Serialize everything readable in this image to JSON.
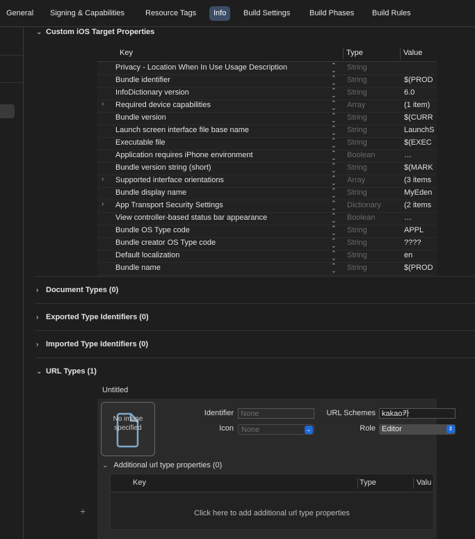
{
  "tabs": [
    "General",
    "Signing & Capabilities",
    "Resource Tags",
    "Info",
    "Build Settings",
    "Build Phases",
    "Build Rules"
  ],
  "active_tab": "Info",
  "sections": {
    "custom_ios": "Custom iOS Target Properties",
    "document_types": "Document Types (0)",
    "exported_types": "Exported Type Identifiers (0)",
    "imported_types": "Imported Type Identifiers (0)",
    "url_types": "URL Types (1)"
  },
  "plist_headers": {
    "key": "Key",
    "type": "Type",
    "value": "Value"
  },
  "plist_rows": [
    {
      "key": "Privacy - Location When In Use Usage Description",
      "type": "String",
      "value": "",
      "expandable": false
    },
    {
      "key": "Bundle identifier",
      "type": "String",
      "value": "$(PROD",
      "expandable": false
    },
    {
      "key": "InfoDictionary version",
      "type": "String",
      "value": "6.0",
      "expandable": false
    },
    {
      "key": "Required device capabilities",
      "type": "Array",
      "value": "(1 item)",
      "expandable": true
    },
    {
      "key": "Bundle version",
      "type": "String",
      "value": "$(CURR",
      "expandable": false
    },
    {
      "key": "Launch screen interface file base name",
      "type": "String",
      "value": "LaunchS",
      "expandable": false
    },
    {
      "key": "Executable file",
      "type": "String",
      "value": "$(EXEC",
      "expandable": false
    },
    {
      "key": "Application requires iPhone environment",
      "type": "Boolean",
      "value": "…",
      "expandable": false
    },
    {
      "key": "Bundle version string (short)",
      "type": "String",
      "value": "$(MARK",
      "expandable": false
    },
    {
      "key": "Supported interface orientations",
      "type": "Array",
      "value": "(3 items",
      "expandable": true
    },
    {
      "key": "Bundle display name",
      "type": "String",
      "value": "MyEden",
      "expandable": false
    },
    {
      "key": "App Transport Security Settings",
      "type": "Dictionary",
      "value": "(2 items",
      "expandable": true
    },
    {
      "key": "View controller-based status bar appearance",
      "type": "Boolean",
      "value": "…",
      "expandable": false
    },
    {
      "key": "Bundle OS Type code",
      "type": "String",
      "value": "APPL",
      "expandable": false
    },
    {
      "key": "Bundle creator OS Type code",
      "type": "String",
      "value": "????",
      "expandable": false
    },
    {
      "key": "Default localization",
      "type": "String",
      "value": "en",
      "expandable": false
    },
    {
      "key": "Bundle name",
      "type": "String",
      "value": "$(PROD",
      "expandable": false
    }
  ],
  "url_type": {
    "title": "Untitled",
    "no_image": "No image specified",
    "identifier_label": "Identifier",
    "identifier_placeholder": "None",
    "icon_label": "Icon",
    "icon_value": "None",
    "url_schemes_label": "URL Schemes",
    "url_schemes_value": "kakao카",
    "role_label": "Role",
    "role_value": "Editor",
    "additional_title": "Additional url type properties (0)",
    "sub_headers": {
      "key": "Key",
      "type": "Type",
      "value": "Valu"
    },
    "placeholder": "Click here to add additional url type properties"
  },
  "colors": {
    "accent": "#1f6bdc",
    "active_tab": "#3d4d66",
    "background": "#1e1e1e"
  }
}
